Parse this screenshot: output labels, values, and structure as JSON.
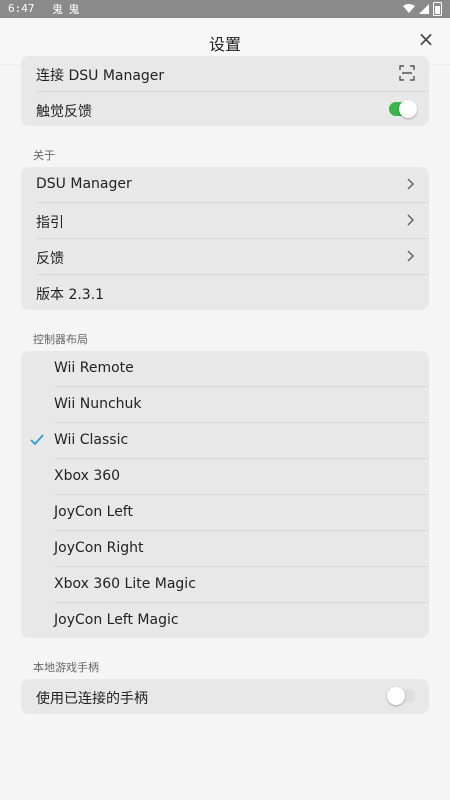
{
  "status": {
    "time": "6:47",
    "notif_icons": "鬼 鬼"
  },
  "header": {
    "title": "设置",
    "close_glyph": "×"
  },
  "top_group": {
    "rows": [
      {
        "label": "连接 DSU Manager",
        "icon": "scan-icon"
      },
      {
        "label": "触觉反馈",
        "toggle": true
      }
    ]
  },
  "about": {
    "title": "关于",
    "rows": [
      {
        "label": "DSU Manager"
      },
      {
        "label": "指引"
      },
      {
        "label": "反馈"
      },
      {
        "label": "版本 2.3.1"
      }
    ]
  },
  "layout": {
    "title": "控制器布局",
    "selected_index": 2,
    "items": [
      "Wii Remote",
      "Wii Nunchuk",
      "Wii Classic",
      "Xbox 360",
      "JoyCon Left",
      "JoyCon Right",
      "Xbox 360 Lite Magic",
      "JoyCon Left Magic"
    ]
  },
  "local": {
    "title": "本地游戏手柄",
    "rows": [
      {
        "label": "使用已连接的手柄",
        "toggle": false
      }
    ]
  },
  "colors": {
    "accent": "#39b54a",
    "check": "#2a9fd6"
  }
}
